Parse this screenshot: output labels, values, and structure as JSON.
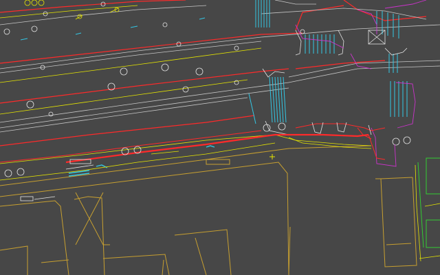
{
  "drawing": {
    "background": "#474747",
    "colors": {
      "road_edge": "#ff2a2a",
      "road_line": "#c8c8c8",
      "kerb": "#e6e600",
      "building": "#c8a030",
      "crossing": "#33c8e6",
      "cyan": "#33c8e6",
      "magenta": "#cc33cc",
      "green": "#33cc33",
      "white": "#e6e6e6",
      "tan": "#d6b878"
    }
  }
}
